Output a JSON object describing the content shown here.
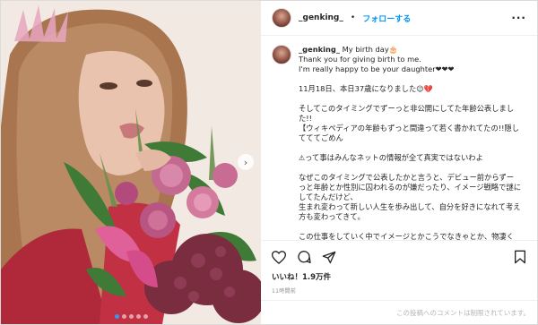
{
  "header": {
    "username": "_genking_",
    "separator": "•",
    "follow_label": "フォローする",
    "more_label": "···"
  },
  "caption": {
    "username": "_genking_",
    "lines": [
      "My birth day",
      "Thank you for giving birth to me.",
      "I'm really happy to be your daughter❤❤❤",
      "",
      "11月18日、本日37歳になりました",
      "",
      "そしてこのタイミングでずーっと非公開にしてた年齢公表しました!!",
      "【ウィキペディアの年齢もずっと間違って若く書かれてたの!!隠してててごめん",
      "",
      "って事はみんなネットの情報が全て真実ではないわよ",
      "",
      "なぜこのタイミングで公表したかと言うと、デビュー前からずーっと年齢とか性別に囚われるのが嫌だったり、イメージ戦略で謎にしてたんだけど、",
      "生まれ変わって新しい人生を歩み出して、自分を好きになれて考え方も変わってきて。",
      "",
      "この仕事をしていく中でイメージとかこうでなきゃとか、物凄く"
    ],
    "emoji": {
      "birthday": "🎂",
      "age_line": "😉💔",
      "truth_line": "⚠"
    }
  },
  "actions": {
    "like_icon": "heart-icon",
    "comment_icon": "comment-icon",
    "share_icon": "share-icon",
    "save_icon": "bookmark-icon",
    "likes_text": "いいね！1.9万件",
    "time_text": "11時間前"
  },
  "comments": {
    "disabled_text": "この投稿へのコメントは制限されています。"
  },
  "carousel": {
    "next_label": "›",
    "slide_count": 5,
    "active_slide": 1
  },
  "colors": {
    "follow_blue": "#0095f6",
    "active_dot": "#3897f0"
  }
}
